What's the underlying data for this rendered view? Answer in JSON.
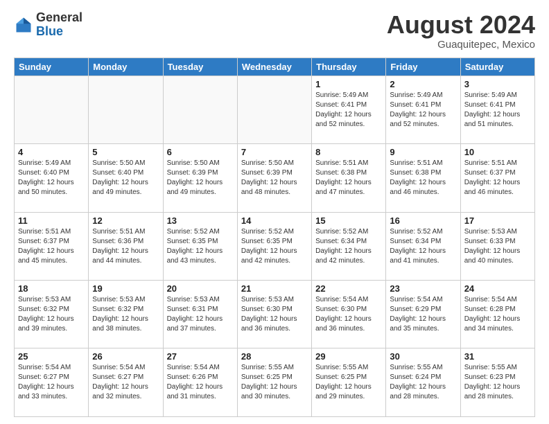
{
  "header": {
    "logo_general": "General",
    "logo_blue": "Blue",
    "month": "August 2024",
    "location": "Guaquitepec, Mexico"
  },
  "days_of_week": [
    "Sunday",
    "Monday",
    "Tuesday",
    "Wednesday",
    "Thursday",
    "Friday",
    "Saturday"
  ],
  "weeks": [
    [
      {
        "day": "",
        "info": ""
      },
      {
        "day": "",
        "info": ""
      },
      {
        "day": "",
        "info": ""
      },
      {
        "day": "",
        "info": ""
      },
      {
        "day": "1",
        "info": "Sunrise: 5:49 AM\nSunset: 6:41 PM\nDaylight: 12 hours\nand 52 minutes."
      },
      {
        "day": "2",
        "info": "Sunrise: 5:49 AM\nSunset: 6:41 PM\nDaylight: 12 hours\nand 52 minutes."
      },
      {
        "day": "3",
        "info": "Sunrise: 5:49 AM\nSunset: 6:41 PM\nDaylight: 12 hours\nand 51 minutes."
      }
    ],
    [
      {
        "day": "4",
        "info": "Sunrise: 5:49 AM\nSunset: 6:40 PM\nDaylight: 12 hours\nand 50 minutes."
      },
      {
        "day": "5",
        "info": "Sunrise: 5:50 AM\nSunset: 6:40 PM\nDaylight: 12 hours\nand 49 minutes."
      },
      {
        "day": "6",
        "info": "Sunrise: 5:50 AM\nSunset: 6:39 PM\nDaylight: 12 hours\nand 49 minutes."
      },
      {
        "day": "7",
        "info": "Sunrise: 5:50 AM\nSunset: 6:39 PM\nDaylight: 12 hours\nand 48 minutes."
      },
      {
        "day": "8",
        "info": "Sunrise: 5:51 AM\nSunset: 6:38 PM\nDaylight: 12 hours\nand 47 minutes."
      },
      {
        "day": "9",
        "info": "Sunrise: 5:51 AM\nSunset: 6:38 PM\nDaylight: 12 hours\nand 46 minutes."
      },
      {
        "day": "10",
        "info": "Sunrise: 5:51 AM\nSunset: 6:37 PM\nDaylight: 12 hours\nand 46 minutes."
      }
    ],
    [
      {
        "day": "11",
        "info": "Sunrise: 5:51 AM\nSunset: 6:37 PM\nDaylight: 12 hours\nand 45 minutes."
      },
      {
        "day": "12",
        "info": "Sunrise: 5:51 AM\nSunset: 6:36 PM\nDaylight: 12 hours\nand 44 minutes."
      },
      {
        "day": "13",
        "info": "Sunrise: 5:52 AM\nSunset: 6:35 PM\nDaylight: 12 hours\nand 43 minutes."
      },
      {
        "day": "14",
        "info": "Sunrise: 5:52 AM\nSunset: 6:35 PM\nDaylight: 12 hours\nand 42 minutes."
      },
      {
        "day": "15",
        "info": "Sunrise: 5:52 AM\nSunset: 6:34 PM\nDaylight: 12 hours\nand 42 minutes."
      },
      {
        "day": "16",
        "info": "Sunrise: 5:52 AM\nSunset: 6:34 PM\nDaylight: 12 hours\nand 41 minutes."
      },
      {
        "day": "17",
        "info": "Sunrise: 5:53 AM\nSunset: 6:33 PM\nDaylight: 12 hours\nand 40 minutes."
      }
    ],
    [
      {
        "day": "18",
        "info": "Sunrise: 5:53 AM\nSunset: 6:32 PM\nDaylight: 12 hours\nand 39 minutes."
      },
      {
        "day": "19",
        "info": "Sunrise: 5:53 AM\nSunset: 6:32 PM\nDaylight: 12 hours\nand 38 minutes."
      },
      {
        "day": "20",
        "info": "Sunrise: 5:53 AM\nSunset: 6:31 PM\nDaylight: 12 hours\nand 37 minutes."
      },
      {
        "day": "21",
        "info": "Sunrise: 5:53 AM\nSunset: 6:30 PM\nDaylight: 12 hours\nand 36 minutes."
      },
      {
        "day": "22",
        "info": "Sunrise: 5:54 AM\nSunset: 6:30 PM\nDaylight: 12 hours\nand 36 minutes."
      },
      {
        "day": "23",
        "info": "Sunrise: 5:54 AM\nSunset: 6:29 PM\nDaylight: 12 hours\nand 35 minutes."
      },
      {
        "day": "24",
        "info": "Sunrise: 5:54 AM\nSunset: 6:28 PM\nDaylight: 12 hours\nand 34 minutes."
      }
    ],
    [
      {
        "day": "25",
        "info": "Sunrise: 5:54 AM\nSunset: 6:27 PM\nDaylight: 12 hours\nand 33 minutes."
      },
      {
        "day": "26",
        "info": "Sunrise: 5:54 AM\nSunset: 6:27 PM\nDaylight: 12 hours\nand 32 minutes."
      },
      {
        "day": "27",
        "info": "Sunrise: 5:54 AM\nSunset: 6:26 PM\nDaylight: 12 hours\nand 31 minutes."
      },
      {
        "day": "28",
        "info": "Sunrise: 5:55 AM\nSunset: 6:25 PM\nDaylight: 12 hours\nand 30 minutes."
      },
      {
        "day": "29",
        "info": "Sunrise: 5:55 AM\nSunset: 6:25 PM\nDaylight: 12 hours\nand 29 minutes."
      },
      {
        "day": "30",
        "info": "Sunrise: 5:55 AM\nSunset: 6:24 PM\nDaylight: 12 hours\nand 28 minutes."
      },
      {
        "day": "31",
        "info": "Sunrise: 5:55 AM\nSunset: 6:23 PM\nDaylight: 12 hours\nand 28 minutes."
      }
    ]
  ]
}
